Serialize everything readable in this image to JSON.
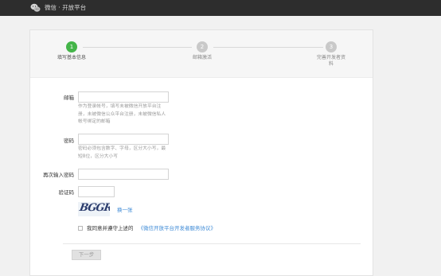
{
  "header": {
    "logo_icon": "wechat-icon",
    "title": "微信 · 开放平台"
  },
  "steps": [
    {
      "number": "1",
      "label": "填写基本信息",
      "state": "active"
    },
    {
      "number": "2",
      "label": "邮箱激活",
      "state": "pending"
    },
    {
      "number": "3",
      "label": "完善开发者资料",
      "state": "pending"
    }
  ],
  "form": {
    "email": {
      "label": "邮箱",
      "value": "",
      "hint": "作为登录帐号，填写未被微信开放平台注册，未被微信公众平台注册，未被微信私人帐号绑定的邮箱"
    },
    "password": {
      "label": "密码",
      "value": "",
      "hint": "密码必须包含数字、字母，区分大小写，最短8位，区分大小写"
    },
    "confirm_password": {
      "label": "再次输入密码",
      "value": ""
    },
    "captcha": {
      "label": "验证码",
      "value": "",
      "image_text": "BGGR",
      "refresh_label": "换一张"
    },
    "agreement": {
      "checked": false,
      "text": "我同意并遵守上述的",
      "link_text": "《微信开放平台开发者服务协议》"
    },
    "next_button": "下一步"
  },
  "colors": {
    "topbar": "#2d2d2d",
    "active_step": "#44b549",
    "pending_step": "#c9c9c9",
    "link": "#3d8ad6"
  }
}
